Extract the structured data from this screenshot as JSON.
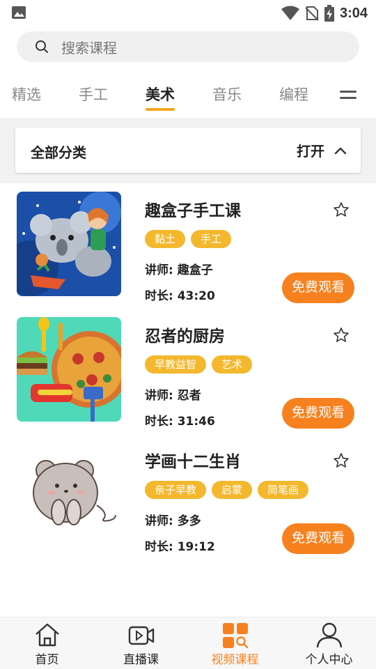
{
  "status_bar": {
    "time": "3:04",
    "icons": [
      "image-icon",
      "wifi-icon",
      "no-sim-icon",
      "battery-charging-icon"
    ]
  },
  "search": {
    "placeholder": "搜索课程"
  },
  "tabs": [
    {
      "label": "精选",
      "active": false
    },
    {
      "label": "手工",
      "active": false
    },
    {
      "label": "美术",
      "active": true
    },
    {
      "label": "音乐",
      "active": false
    },
    {
      "label": "编程",
      "active": false
    }
  ],
  "tab_menu_icon": "menu-icon",
  "category": {
    "title": "全部分类",
    "toggle_label": "打开",
    "toggle_icon": "chevron-up-icon"
  },
  "courses": [
    {
      "title": "趣盒子手工课",
      "tags": [
        "黏土",
        "手工"
      ],
      "teacher": "讲师: 趣盒子",
      "duration": "时长: 43:20",
      "button": "免费观看"
    },
    {
      "title": "忍者的厨房",
      "tags": [
        "早教益智",
        "艺术"
      ],
      "teacher": "讲师: 忍者",
      "duration": "时长: 31:46",
      "button": "免费观看"
    },
    {
      "title": "学画十二生肖",
      "tags": [
        "亲子早教",
        "启蒙",
        "简笔画"
      ],
      "teacher": "讲师: 多多",
      "duration": "时长: 19:12",
      "button": "免费观看"
    }
  ],
  "bottom_nav": [
    {
      "label": "首页",
      "icon": "home-icon",
      "active": false
    },
    {
      "label": "直播课",
      "icon": "video-camera-icon",
      "active": false
    },
    {
      "label": "视频课程",
      "icon": "video-course-icon",
      "active": true
    },
    {
      "label": "个人中心",
      "icon": "user-icon",
      "active": false
    }
  ],
  "colors": {
    "accent_orange": "#f7811f",
    "tag_yellow": "#f4b82e",
    "tab_underline": "#f5a623",
    "active_nav": "#f7811f"
  }
}
